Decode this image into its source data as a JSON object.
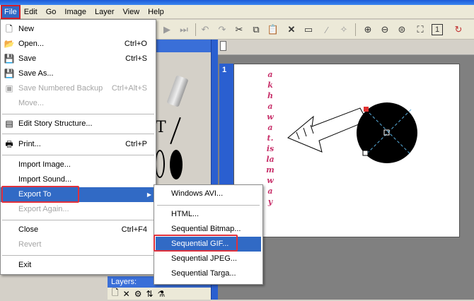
{
  "menubar": {
    "items": [
      "File",
      "Edit",
      "Go",
      "Image",
      "Layer",
      "View",
      "Help"
    ]
  },
  "file_menu": {
    "items": [
      {
        "label": "New",
        "shortcut": "",
        "icon": "new-doc-icon",
        "enabled": true
      },
      {
        "label": "Open...",
        "shortcut": "Ctrl+O",
        "icon": "open-folder-icon",
        "enabled": true
      },
      {
        "label": "Save",
        "shortcut": "Ctrl+S",
        "icon": "save-disk-icon",
        "enabled": true
      },
      {
        "label": "Save As...",
        "shortcut": "",
        "icon": "save-as-icon",
        "enabled": true
      },
      {
        "label": "Save Numbered Backup",
        "shortcut": "Ctrl+Alt+S",
        "icon": "backup-icon",
        "enabled": false
      },
      {
        "label": "Move...",
        "shortcut": "",
        "icon": "",
        "enabled": false
      },
      {
        "label": "Edit Story Structure...",
        "shortcut": "",
        "icon": "story-structure-icon",
        "enabled": true
      },
      {
        "label": "Print...",
        "shortcut": "Ctrl+P",
        "icon": "printer-icon",
        "enabled": true
      },
      {
        "label": "Import Image...",
        "shortcut": "",
        "icon": "",
        "enabled": true
      },
      {
        "label": "Import Sound...",
        "shortcut": "",
        "icon": "",
        "enabled": true
      },
      {
        "label": "Export To",
        "shortcut": "",
        "icon": "",
        "enabled": true
      },
      {
        "label": "Export Again...",
        "shortcut": "",
        "icon": "",
        "enabled": false
      },
      {
        "label": "Close",
        "shortcut": "Ctrl+F4",
        "icon": "",
        "enabled": true
      },
      {
        "label": "Revert",
        "shortcut": "",
        "icon": "",
        "enabled": false
      },
      {
        "label": "Exit",
        "shortcut": "",
        "icon": "",
        "enabled": true
      }
    ]
  },
  "export_submenu": {
    "items": [
      "Windows AVI...",
      "HTML...",
      "Sequential Bitmap...",
      "Sequential GIF...",
      "Sequential JPEG...",
      "Sequential Targa..."
    ],
    "selected": "Sequential GIF..."
  },
  "canvas": {
    "frame_number": "1",
    "vertical_text": "akhawat.islamway"
  },
  "panels": {
    "layers_title": "Layers:"
  },
  "colors": {
    "menu_highlight": "#316ac5",
    "annotation_red": "#e0313c",
    "text_magenta": "#c8306a"
  }
}
